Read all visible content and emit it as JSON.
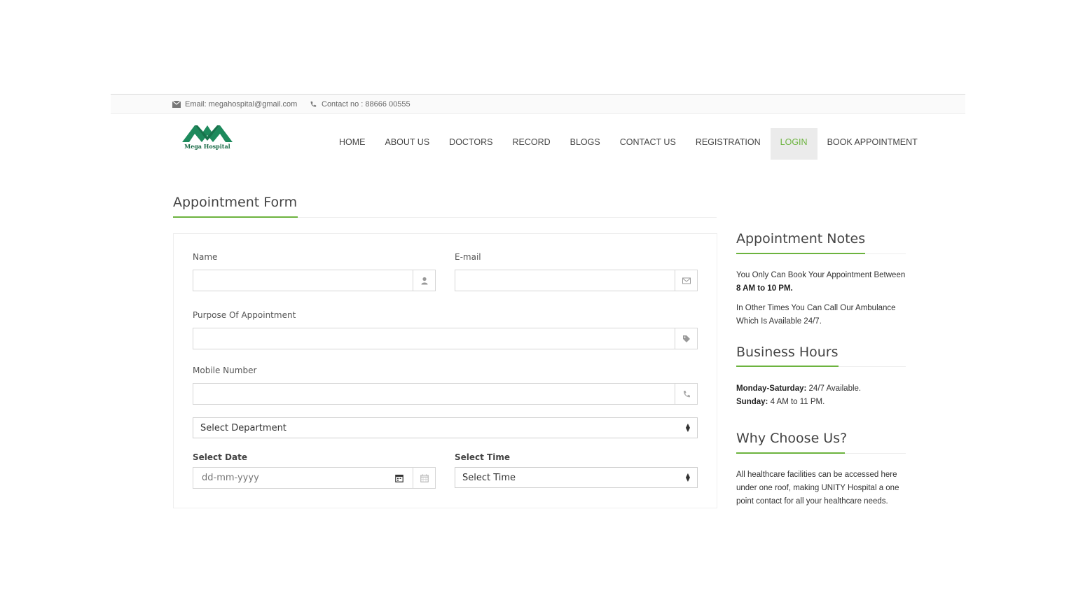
{
  "topbar": {
    "email_icon": "envelope-icon",
    "email_text": "Email: megahospital@gmail.com",
    "phone_icon": "phone-icon",
    "phone_text": "Contact no : 88666 00555"
  },
  "logo": {
    "text": "Mega Hospital"
  },
  "nav": {
    "items": [
      "HOME",
      "ABOUT US",
      "DOCTORS",
      "RECORD",
      "BLOGS",
      "CONTACT US",
      "REGISTRATION",
      "LOGIN",
      "BOOK APPOINTMENT"
    ],
    "active": "LOGIN"
  },
  "form": {
    "title": "Appointment Form",
    "name_label": "Name",
    "email_label": "E-mail",
    "purpose_label": "Purpose Of Appointment",
    "mobile_label": "Mobile Number",
    "department_select": "Select Department",
    "date_label": "Select Date",
    "date_placeholder": "dd-mm-yyyy",
    "time_label": "Select Time",
    "time_select": "Select Time"
  },
  "sidebar": {
    "notes_title": "Appointment Notes",
    "notes_p1_a": "You Only Can Book Your Appointment Between ",
    "notes_p1_b": "8 AM to 10 PM.",
    "notes_p2": "In Other Times You Can Call Our Ambulance Which Is Available 24/7.",
    "hours_title": "Business Hours",
    "hours_weekday_label": "Monday-Saturday:",
    "hours_weekday_value": " 24/7 Available.",
    "hours_sunday_label": "Sunday:",
    "hours_sunday_value": " 4 AM to 11 PM.",
    "why_title": "Why Choose Us?",
    "why_text": "All healthcare facilities can be accessed here under one roof, making UNITY Hospital a one point contact for all your healthcare needs."
  },
  "colors": {
    "accent": "#6cb33e",
    "logo": "#1d8a5c",
    "nav_active_bg": "#ebebeb"
  }
}
